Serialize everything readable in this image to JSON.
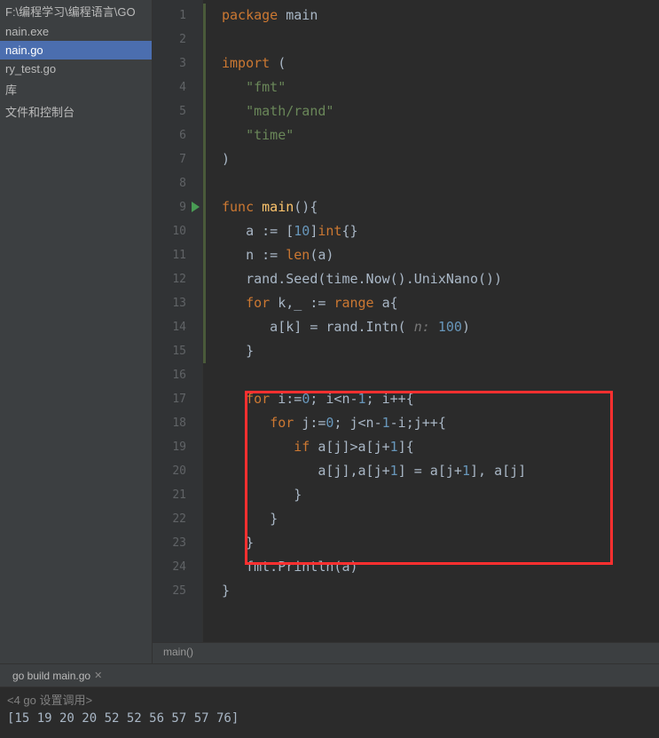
{
  "sidebar": {
    "items": [
      {
        "label": "F:\\编程学习\\编程语言\\GO",
        "selected": false
      },
      {
        "label": "nain.exe",
        "selected": false
      },
      {
        "label": "nain.go",
        "selected": true
      },
      {
        "label": "ry_test.go",
        "selected": false
      },
      {
        "label": "库",
        "selected": false
      },
      {
        "label": "文件和控制台",
        "selected": false
      }
    ]
  },
  "code": {
    "lines": [
      {
        "n": 1,
        "tokens": [
          {
            "t": "package ",
            "c": "kw"
          },
          {
            "t": "main",
            "c": "pkg"
          }
        ]
      },
      {
        "n": 2,
        "tokens": []
      },
      {
        "n": 3,
        "tokens": [
          {
            "t": "import ",
            "c": "kw"
          },
          {
            "t": "(",
            "c": "punct"
          }
        ]
      },
      {
        "n": 4,
        "tokens": [
          {
            "t": "   ",
            "c": ""
          },
          {
            "t": "\"fmt\"",
            "c": "str"
          }
        ]
      },
      {
        "n": 5,
        "tokens": [
          {
            "t": "   ",
            "c": ""
          },
          {
            "t": "\"math/rand\"",
            "c": "str"
          }
        ]
      },
      {
        "n": 6,
        "tokens": [
          {
            "t": "   ",
            "c": ""
          },
          {
            "t": "\"time\"",
            "c": "str"
          }
        ]
      },
      {
        "n": 7,
        "tokens": [
          {
            "t": ")",
            "c": "punct"
          }
        ]
      },
      {
        "n": 8,
        "tokens": []
      },
      {
        "n": 9,
        "run": true,
        "tokens": [
          {
            "t": "func ",
            "c": "kw"
          },
          {
            "t": "main",
            "c": "fn"
          },
          {
            "t": "(){",
            "c": "punct"
          }
        ]
      },
      {
        "n": 10,
        "tokens": [
          {
            "t": "   a := [",
            "c": "ident"
          },
          {
            "t": "10",
            "c": "num"
          },
          {
            "t": "]",
            "c": "punct"
          },
          {
            "t": "int",
            "c": "type"
          },
          {
            "t": "{}",
            "c": "punct"
          }
        ]
      },
      {
        "n": 11,
        "tokens": [
          {
            "t": "   n := ",
            "c": "ident"
          },
          {
            "t": "len",
            "c": "type"
          },
          {
            "t": "(a)",
            "c": "punct"
          }
        ]
      },
      {
        "n": 12,
        "tokens": [
          {
            "t": "   rand.Seed(time.Now().UnixNano())",
            "c": "ident"
          }
        ]
      },
      {
        "n": 13,
        "tokens": [
          {
            "t": "   ",
            "c": ""
          },
          {
            "t": "for ",
            "c": "kw"
          },
          {
            "t": "k",
            "c": "ident"
          },
          {
            "t": ",",
            "c": "punct"
          },
          {
            "t": "_ := ",
            "c": "ident"
          },
          {
            "t": "range ",
            "c": "kw"
          },
          {
            "t": "a{",
            "c": "ident"
          }
        ]
      },
      {
        "n": 14,
        "tokens": [
          {
            "t": "      a[k] = rand.Intn( ",
            "c": "ident"
          },
          {
            "t": "n: ",
            "c": "param-hint"
          },
          {
            "t": "100",
            "c": "num"
          },
          {
            "t": ")",
            "c": "punct"
          }
        ]
      },
      {
        "n": 15,
        "tokens": [
          {
            "t": "   }",
            "c": "ident"
          }
        ]
      },
      {
        "n": 16,
        "tokens": []
      },
      {
        "n": 17,
        "tokens": [
          {
            "t": "   ",
            "c": ""
          },
          {
            "t": "for ",
            "c": "kw"
          },
          {
            "t": "i:=",
            "c": "ident"
          },
          {
            "t": "0",
            "c": "num"
          },
          {
            "t": "; i<n-",
            "c": "ident"
          },
          {
            "t": "1",
            "c": "num"
          },
          {
            "t": "; i++{",
            "c": "ident"
          }
        ]
      },
      {
        "n": 18,
        "tokens": [
          {
            "t": "      ",
            "c": ""
          },
          {
            "t": "for ",
            "c": "kw"
          },
          {
            "t": "j:=",
            "c": "ident"
          },
          {
            "t": "0",
            "c": "num"
          },
          {
            "t": "; j<n-",
            "c": "ident"
          },
          {
            "t": "1",
            "c": "num"
          },
          {
            "t": "-i;j++{",
            "c": "ident"
          }
        ]
      },
      {
        "n": 19,
        "tokens": [
          {
            "t": "         ",
            "c": ""
          },
          {
            "t": "if ",
            "c": "kw"
          },
          {
            "t": "a[j]>a[j+",
            "c": "ident"
          },
          {
            "t": "1",
            "c": "num"
          },
          {
            "t": "]{",
            "c": "ident"
          }
        ]
      },
      {
        "n": 20,
        "tokens": [
          {
            "t": "            a[j]",
            "c": "ident"
          },
          {
            "t": ",",
            "c": "punct"
          },
          {
            "t": "a[j+",
            "c": "ident"
          },
          {
            "t": "1",
            "c": "num"
          },
          {
            "t": "] = a[j+",
            "c": "ident"
          },
          {
            "t": "1",
            "c": "num"
          },
          {
            "t": "]",
            "c": "ident"
          },
          {
            "t": ", ",
            "c": "punct"
          },
          {
            "t": "a[j]",
            "c": "ident"
          }
        ]
      },
      {
        "n": 21,
        "tokens": [
          {
            "t": "         }",
            "c": "ident"
          }
        ]
      },
      {
        "n": 22,
        "tokens": [
          {
            "t": "      }",
            "c": "ident"
          }
        ]
      },
      {
        "n": 23,
        "tokens": [
          {
            "t": "   }",
            "c": "ident"
          }
        ]
      },
      {
        "n": 24,
        "tokens": [
          {
            "t": "   fmt.Println(a)",
            "c": "ident"
          }
        ]
      },
      {
        "n": 25,
        "tokens": [
          {
            "t": "}",
            "c": "ident"
          }
        ]
      }
    ]
  },
  "breadcrumb": "main()",
  "terminal_tab": {
    "label": "go build main.go",
    "closable": true
  },
  "terminal": {
    "header": "<4 go 设置调用>",
    "output": "[15 19 20 20 52 52 56 57 57 76]"
  }
}
